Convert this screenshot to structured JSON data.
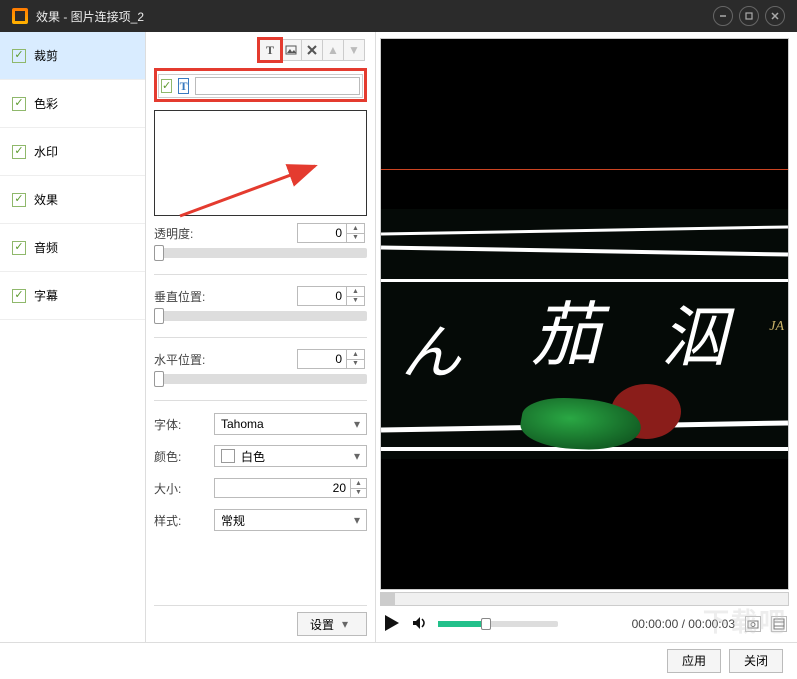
{
  "window": {
    "title": "效果 - 图片连接项_2"
  },
  "sidebar": {
    "items": [
      {
        "label": "裁剪"
      },
      {
        "label": "色彩"
      },
      {
        "label": "水印"
      },
      {
        "label": "效果"
      },
      {
        "label": "音频"
      },
      {
        "label": "字幕"
      }
    ]
  },
  "textInput": {
    "value": ""
  },
  "sliders": {
    "opacity": {
      "label": "透明度:",
      "value": "0"
    },
    "vpos": {
      "label": "垂直位置:",
      "value": "0"
    },
    "hpos": {
      "label": "水平位置:",
      "value": "0"
    }
  },
  "font": {
    "label": "字体:",
    "value": "Tahoma"
  },
  "color": {
    "label": "颜色:",
    "value": "白色"
  },
  "size": {
    "label": "大小:",
    "value": "20"
  },
  "style": {
    "label": "样式:",
    "value": "常规"
  },
  "settingsBtn": "设置",
  "player": {
    "time": "00:00:00 / 00:00:03"
  },
  "footer": {
    "apply": "应用",
    "close": "关闭"
  },
  "watermark": "下载吧"
}
